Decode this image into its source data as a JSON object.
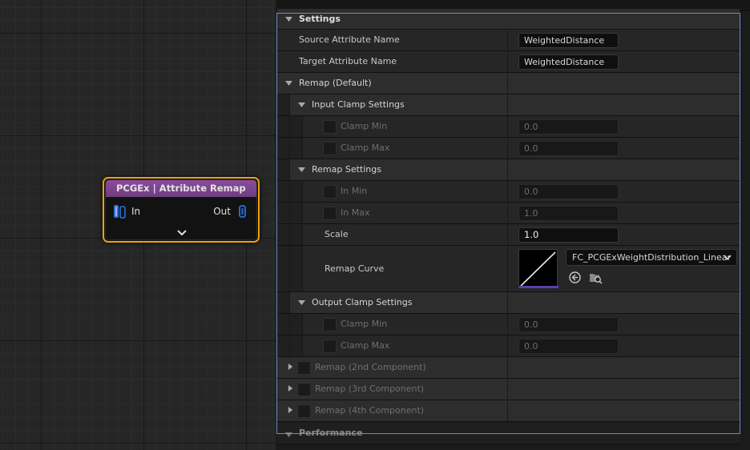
{
  "node": {
    "title": "PCGEx | Attribute Remap",
    "in_label": "In",
    "out_label": "Out",
    "colors": {
      "border": "#e8a217",
      "header": "#7a4588"
    },
    "icons": {
      "in_pin": "pcg-pin-icon",
      "out_pin": "pcg-pin-icon",
      "expand": "chevron-down-icon"
    }
  },
  "details": {
    "settings_label": "Settings",
    "source_attribute": {
      "label": "Source Attribute Name",
      "value": "WeightedDistance"
    },
    "target_attribute": {
      "label": "Target Attribute Name",
      "value": "WeightedDistance"
    },
    "remap_default_label": "Remap (Default)",
    "input_clamp_label": "Input Clamp Settings",
    "input_clamp_min": {
      "label": "Clamp Min",
      "value": "0.0"
    },
    "input_clamp_max": {
      "label": "Clamp Max",
      "value": "0.0"
    },
    "remap_settings_label": "Remap Settings",
    "in_min": {
      "label": "In Min",
      "value": "0.0"
    },
    "in_max": {
      "label": "In Max",
      "value": "1.0"
    },
    "scale": {
      "label": "Scale",
      "value": "1.0"
    },
    "remap_curve": {
      "label": "Remap Curve",
      "asset": "FC_PCGExWeightDistribution_Linear"
    },
    "output_clamp_label": "Output Clamp Settings",
    "output_clamp_min": {
      "label": "Clamp Min",
      "value": "0.0"
    },
    "output_clamp_max": {
      "label": "Clamp Max",
      "value": "0.0"
    },
    "remap_2nd_label": "Remap (2nd Component)",
    "remap_3rd_label": "Remap (3rd Component)",
    "remap_4th_label": "Remap (4th Component)",
    "performance_label": "Performance",
    "colors": {
      "focus_border": "#6b8cc4",
      "curve_underline": "#5b3ea8"
    }
  }
}
